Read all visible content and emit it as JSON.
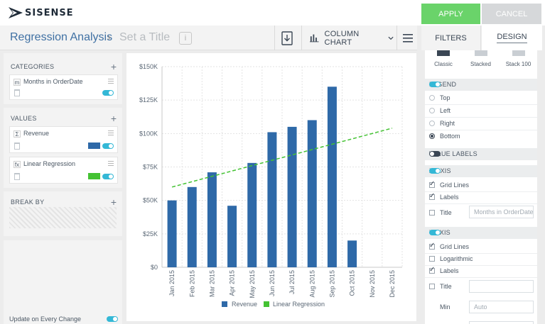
{
  "app": {
    "logo_text": "SISENSE"
  },
  "header": {
    "apply_label": "APPLY",
    "cancel_label": "CANCEL"
  },
  "titlebar": {
    "title": "Regression Analysis",
    "separator": "›",
    "subtitle_placeholder": "Set a Title",
    "info": "i",
    "chart_type_label": "COLUMN CHART"
  },
  "tabs": {
    "filters": "FILTERS",
    "design": "DESIGN"
  },
  "left_panel": {
    "categories": {
      "heading": "CATEGORIES",
      "items": [
        {
          "icon": "m",
          "label": "Months in OrderDate"
        }
      ]
    },
    "values": {
      "heading": "VALUES",
      "items": [
        {
          "icon": "Σ",
          "label": "Revenue",
          "color": "#2e69a8"
        },
        {
          "icon": "fx",
          "label": "Linear Regression",
          "color": "#44c233"
        }
      ]
    },
    "break_by": {
      "heading": "BREAK BY"
    },
    "update_label": "Update on Every Change",
    "plus": "+"
  },
  "design_panel": {
    "styles": [
      "Classic",
      "Stacked",
      "Stack 100"
    ],
    "selected_style": "Classic",
    "legend": {
      "heading": "LEGEND",
      "enabled": true,
      "options": [
        "Top",
        "Left",
        "Right",
        "Bottom"
      ],
      "selected": "Bottom"
    },
    "value_labels": {
      "heading": "VALUE LABELS",
      "enabled": false
    },
    "x_axis": {
      "heading": "X-AXIS",
      "enabled": true,
      "grid_lines": "Grid Lines",
      "labels": "Labels",
      "title": "Title",
      "title_placeholder": "Months in OrderDate"
    },
    "y_axis": {
      "heading": "Y-AXIS",
      "enabled": true,
      "grid_lines": "Grid Lines",
      "logarithmic": "Logarithmic",
      "labels": "Labels",
      "title": "Title",
      "title_placeholder": "",
      "min_label": "Min",
      "min_placeholder": "Auto"
    }
  },
  "colors": {
    "apply": "#6ad36a",
    "revenue": "#2e69a8",
    "regression": "#44c233",
    "accent_toggle": "#34b8d6"
  },
  "chart_data": {
    "type": "bar",
    "categories": [
      "Jan 2015",
      "Feb 2015",
      "Mar 2015",
      "Apr 2015",
      "May 2015",
      "Jun 2015",
      "Jul 2015",
      "Aug 2015",
      "Sep 2015",
      "Oct 2015",
      "Nov 2015",
      "Dec 2015"
    ],
    "series": [
      {
        "name": "Revenue",
        "kind": "bar",
        "color": "#2e69a8",
        "values": [
          50000,
          60000,
          71000,
          46000,
          78000,
          101000,
          105000,
          110000,
          135000,
          20000,
          null,
          null
        ]
      },
      {
        "name": "Linear Regression",
        "kind": "line-dashed",
        "color": "#44c233",
        "start": 60000,
        "end": 104000
      }
    ],
    "ylim": [
      0,
      150000
    ],
    "yticks": [
      "$0",
      "$25K",
      "$50K",
      "$75K",
      "$100K",
      "$125K",
      "$150K"
    ],
    "ytick_values": [
      0,
      25000,
      50000,
      75000,
      100000,
      125000,
      150000
    ],
    "grid": true,
    "legend_position": "bottom"
  }
}
